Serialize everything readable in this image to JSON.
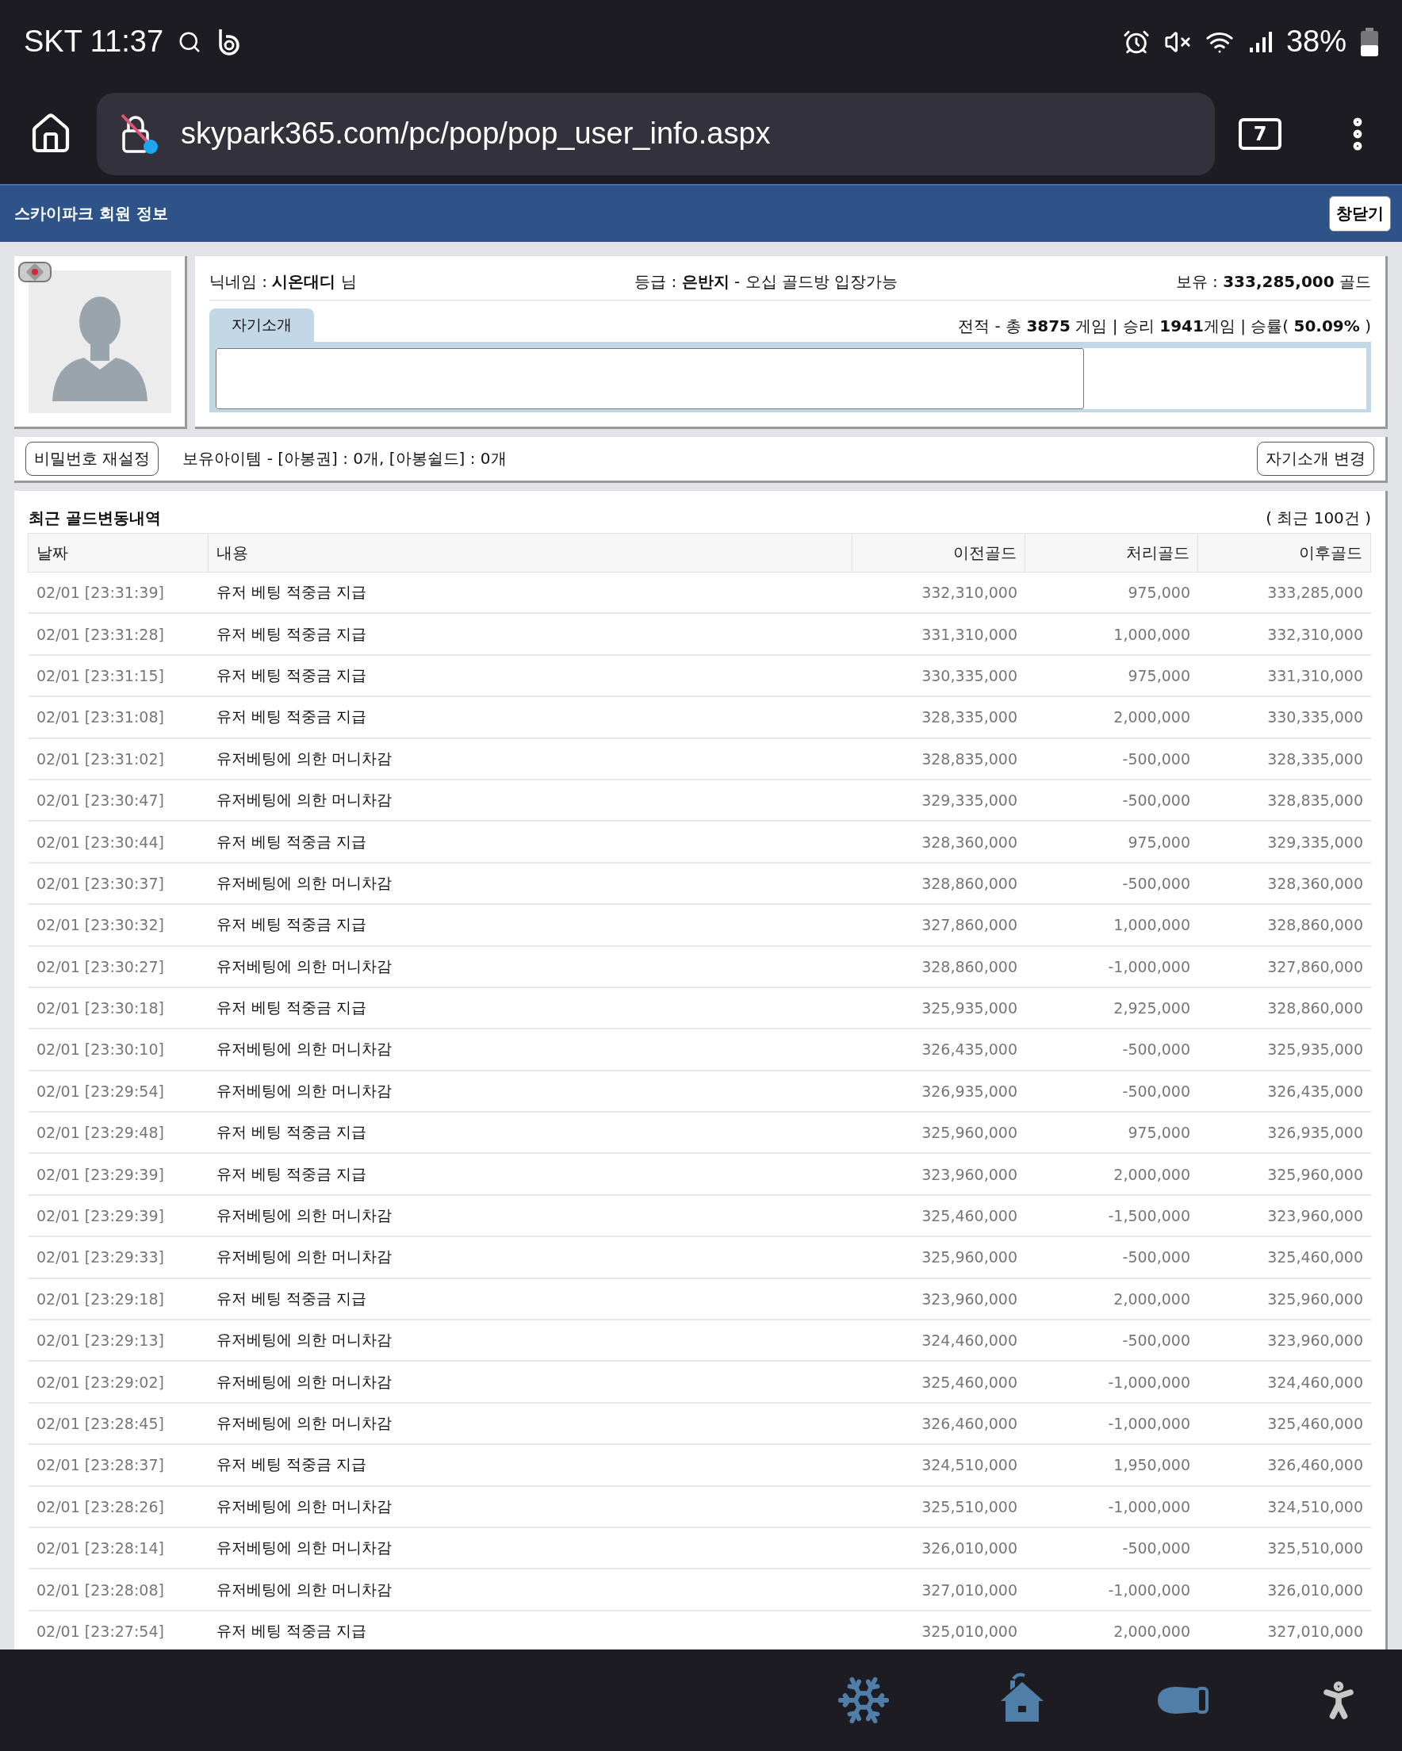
{
  "status_bar": {
    "carrier_time": "SKT 11:37",
    "battery": "38%"
  },
  "browser": {
    "url": "skypark365.com/pc/pop/pop_user_info.aspx",
    "tab_count": "7"
  },
  "header": {
    "title": "스카이파크 회원 정보",
    "close_button": "창닫기"
  },
  "profile": {
    "nickname": "닉네임 : **시온대디** 님",
    "grade": "등급 : **은반지** - 오십 골드방 입장가능",
    "holdings": "보유 : **333,285,000** 골드",
    "record": "전적 - 총 **3875** 게임 | 승리 **1941**게임 | 승률( **50.09%** )",
    "intro_tab": "자기소개"
  },
  "items_bar": {
    "reset_button": "비밀번호 재설정",
    "items": "보유아이템 - [아봉권] : 0개, [아봉쉴드] : 0개",
    "intro_button": "자기소개 변경"
  },
  "history": {
    "title": "최근 골드변동내역",
    "count": "( 최근 100건 )",
    "columns": [
      "날짜",
      "내용",
      "이전골드",
      "처리골드",
      "이후골드"
    ],
    "rows": [
      [
        "02/01 [23:31:39]",
        "유저 베팅 적중금 지급",
        "332,310,000",
        "975,000",
        "333,285,000"
      ],
      [
        "02/01 [23:31:28]",
        "유저 베팅 적중금 지급",
        "331,310,000",
        "1,000,000",
        "332,310,000"
      ],
      [
        "02/01 [23:31:15]",
        "유저 베팅 적중금 지급",
        "330,335,000",
        "975,000",
        "331,310,000"
      ],
      [
        "02/01 [23:31:08]",
        "유저 베팅 적중금 지급",
        "328,335,000",
        "2,000,000",
        "330,335,000"
      ],
      [
        "02/01 [23:31:02]",
        "유저베팅에 의한 머니차감",
        "328,835,000",
        "-500,000",
        "328,335,000"
      ],
      [
        "02/01 [23:30:47]",
        "유저베팅에 의한 머니차감",
        "329,335,000",
        "-500,000",
        "328,835,000"
      ],
      [
        "02/01 [23:30:44]",
        "유저 베팅 적중금 지급",
        "328,360,000",
        "975,000",
        "329,335,000"
      ],
      [
        "02/01 [23:30:37]",
        "유저베팅에 의한 머니차감",
        "328,860,000",
        "-500,000",
        "328,360,000"
      ],
      [
        "02/01 [23:30:32]",
        "유저 베팅 적중금 지급",
        "327,860,000",
        "1,000,000",
        "328,860,000"
      ],
      [
        "02/01 [23:30:27]",
        "유저베팅에 의한 머니차감",
        "328,860,000",
        "-1,000,000",
        "327,860,000"
      ],
      [
        "02/01 [23:30:18]",
        "유저 베팅 적중금 지급",
        "325,935,000",
        "2,925,000",
        "328,860,000"
      ],
      [
        "02/01 [23:30:10]",
        "유저베팅에 의한 머니차감",
        "326,435,000",
        "-500,000",
        "325,935,000"
      ],
      [
        "02/01 [23:29:54]",
        "유저베팅에 의한 머니차감",
        "326,935,000",
        "-500,000",
        "326,435,000"
      ],
      [
        "02/01 [23:29:48]",
        "유저 베팅 적중금 지급",
        "325,960,000",
        "975,000",
        "326,935,000"
      ],
      [
        "02/01 [23:29:39]",
        "유저 베팅 적중금 지급",
        "323,960,000",
        "2,000,000",
        "325,960,000"
      ],
      [
        "02/01 [23:29:39]",
        "유저베팅에 의한 머니차감",
        "325,460,000",
        "-1,500,000",
        "323,960,000"
      ],
      [
        "02/01 [23:29:33]",
        "유저베팅에 의한 머니차감",
        "325,960,000",
        "-500,000",
        "325,460,000"
      ],
      [
        "02/01 [23:29:18]",
        "유저 베팅 적중금 지급",
        "323,960,000",
        "2,000,000",
        "325,960,000"
      ],
      [
        "02/01 [23:29:13]",
        "유저베팅에 의한 머니차감",
        "324,460,000",
        "-500,000",
        "323,960,000"
      ],
      [
        "02/01 [23:29:02]",
        "유저베팅에 의한 머니차감",
        "325,460,000",
        "-1,000,000",
        "324,460,000"
      ],
      [
        "02/01 [23:28:45]",
        "유저베팅에 의한 머니차감",
        "326,460,000",
        "-1,000,000",
        "325,460,000"
      ],
      [
        "02/01 [23:28:37]",
        "유저 베팅 적중금 지급",
        "324,510,000",
        "1,950,000",
        "326,460,000"
      ],
      [
        "02/01 [23:28:26]",
        "유저베팅에 의한 머니차감",
        "325,510,000",
        "-1,000,000",
        "324,510,000"
      ],
      [
        "02/01 [23:28:14]",
        "유저베팅에 의한 머니차감",
        "326,010,000",
        "-500,000",
        "325,510,000"
      ],
      [
        "02/01 [23:28:08]",
        "유저베팅에 의한 머니차감",
        "327,010,000",
        "-1,000,000",
        "326,010,000"
      ],
      [
        "02/01 [23:27:54]",
        "유저 베팅 적중금 지급",
        "325,010,000",
        "2,000,000",
        "327,010,000"
      ]
    ]
  }
}
